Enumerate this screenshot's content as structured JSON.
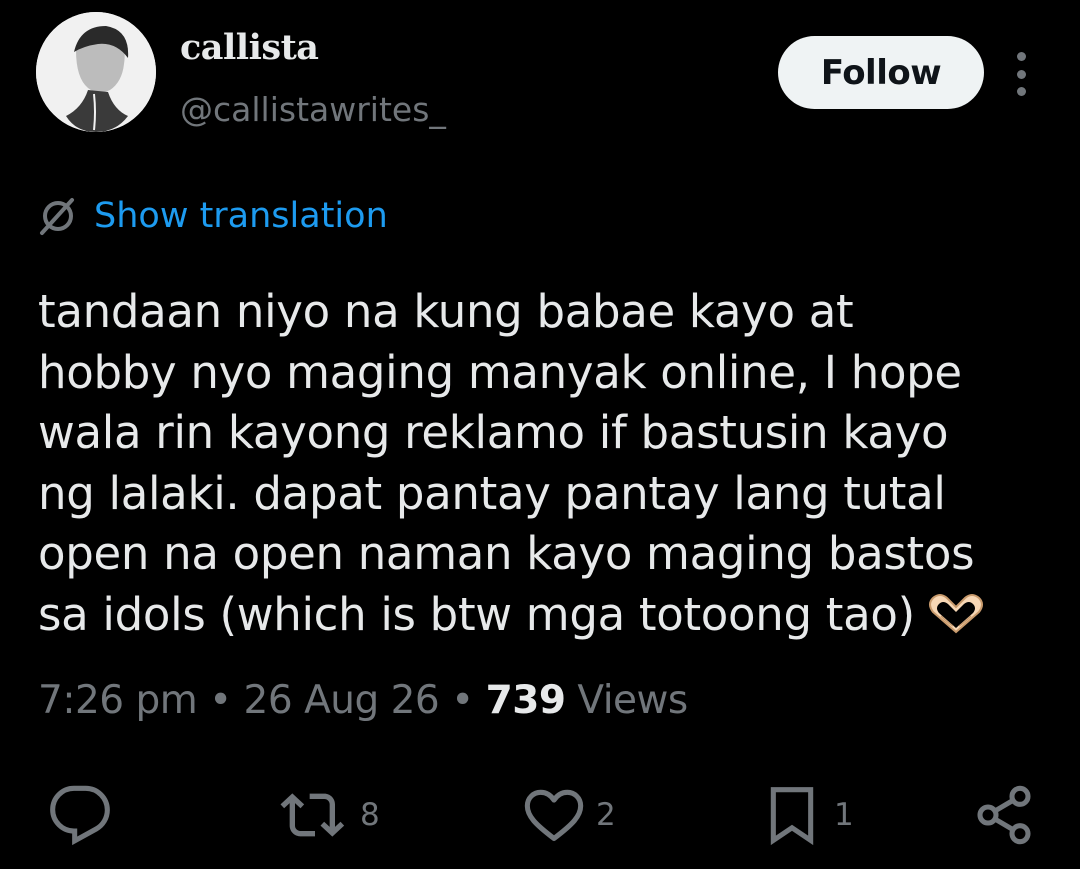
{
  "author": {
    "display_name": "callista",
    "handle": "@callistawrites_"
  },
  "header": {
    "follow_label": "Follow"
  },
  "translation": {
    "label": "Show translation"
  },
  "tweet": {
    "text": "tandaan niyo na kung babae kayo at\nhobby nyo maging manyak online, I hope\nwala rin kayong reklamo if bastusin kayo\nng lalaki. dapat pantay pantay lang tutal\nopen na open naman kayo maging bastos\nsa idols (which is btw mga totoong tao)"
  },
  "meta": {
    "time": "7:26 pm",
    "separator": " • ",
    "date": "26 Aug 26",
    "views_count": "739",
    "views_label": " Views"
  },
  "actions": {
    "reply_count": "",
    "repost_count": "8",
    "like_count": "2",
    "bookmark_count": "1"
  },
  "colors": {
    "background": "#000000",
    "text_primary": "#e7e9ea",
    "text_secondary": "#71767b",
    "link": "#1d9bf0",
    "follow_bg": "#eff3f4"
  }
}
